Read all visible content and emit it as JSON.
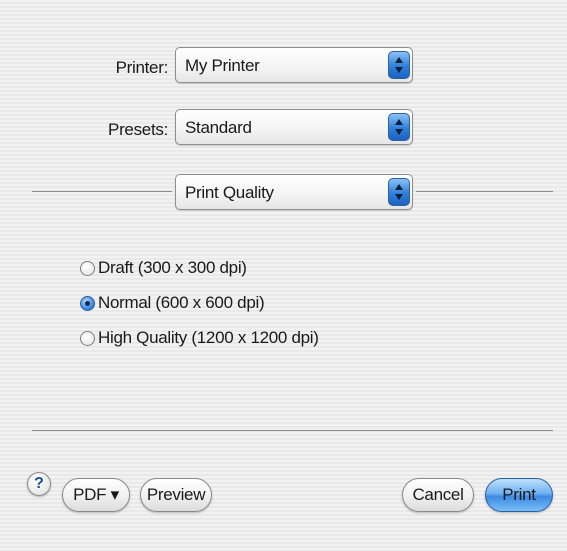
{
  "printer": {
    "label": "Printer:",
    "value": "My Printer"
  },
  "presets": {
    "label": "Presets:",
    "value": "Standard"
  },
  "panel_selector": {
    "value": "Print Quality"
  },
  "quality_options": [
    {
      "label": "Draft (300 x 300 dpi)",
      "selected": false
    },
    {
      "label": "Normal (600 x 600 dpi)",
      "selected": true
    },
    {
      "label": "High Quality (1200 x 1200 dpi)",
      "selected": false
    }
  ],
  "footer": {
    "help_label": "?",
    "pdf_label": "PDF ▾",
    "preview_label": "Preview",
    "cancel_label": "Cancel",
    "print_label": "Print"
  },
  "colors": {
    "accent": "#3d8ae3",
    "background": "#efefef"
  },
  "icons": {
    "popup_arrows": "up-down-arrows-icon",
    "help": "help-icon"
  }
}
